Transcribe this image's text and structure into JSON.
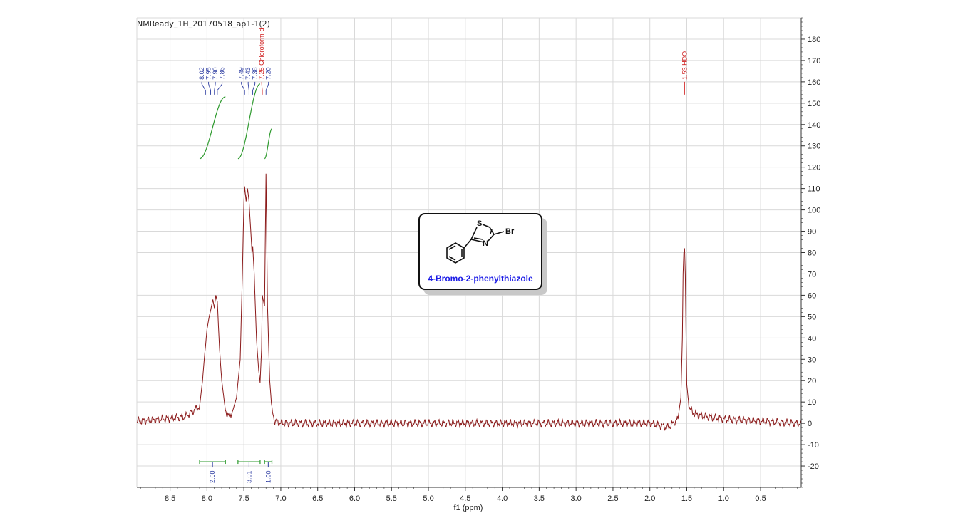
{
  "title": "NMReady_1H_20170518_ap1-1(2)",
  "compound": {
    "name": "4-Bromo-2-phenylthiazole",
    "atom_S": "S",
    "atom_N": "N",
    "atom_Br": "Br",
    "name_color": "#1a1ae6"
  },
  "colors": {
    "spectrum": "#8b1a1a",
    "integral": "#2e9a2e",
    "peak_label": "#2a3aa0",
    "solvent_label": "#d02020",
    "grid": "#d9d9d9",
    "axis": "#333333"
  },
  "chart_data": {
    "type": "line",
    "xlabel": "f1 (ppm)",
    "ylabel": "",
    "x_reversed": true,
    "xlim": [
      8.95,
      -0.05
    ],
    "ylim": [
      -30,
      190
    ],
    "grid": true,
    "x_ticks": [
      "8.5",
      "8.0",
      "7.5",
      "7.0",
      "6.5",
      "6.0",
      "5.5",
      "5.0",
      "4.5",
      "4.0",
      "3.5",
      "3.0",
      "2.5",
      "2.0",
      "1.5",
      "1.0",
      "0.5"
    ],
    "y_ticks": [
      "-20",
      "-10",
      "0",
      "10",
      "20",
      "30",
      "40",
      "50",
      "60",
      "70",
      "80",
      "90",
      "100",
      "110",
      "120",
      "130",
      "140",
      "150",
      "160",
      "170",
      "180"
    ],
    "series": [
      {
        "x": [
          8.95,
          8.6,
          8.3,
          8.1,
          8.06,
          8.03,
          8.02,
          8.0,
          7.97,
          7.95,
          7.92,
          7.9,
          7.88,
          7.86,
          7.83,
          7.8,
          7.75,
          7.7,
          7.65,
          7.6,
          7.55,
          7.52,
          7.5,
          7.49,
          7.47,
          7.45,
          7.43,
          7.41,
          7.39,
          7.38,
          7.36,
          7.33,
          7.3,
          7.28,
          7.26,
          7.25,
          7.24,
          7.22,
          7.2,
          7.18,
          7.15,
          7.12,
          7.08,
          7.0,
          6.5,
          6.0,
          5.0,
          4.0,
          3.0,
          2.0,
          1.75,
          1.62,
          1.58,
          1.56,
          1.55,
          1.54,
          1.53,
          1.52,
          1.51,
          1.5,
          1.47,
          1.42,
          1.35,
          1.2,
          1.0,
          0.5,
          0.0,
          -0.05
        ],
        "y": [
          1,
          2,
          3,
          8,
          20,
          33,
          36,
          44,
          50,
          53,
          58,
          54,
          60,
          57,
          35,
          20,
          6,
          3,
          6,
          12,
          30,
          70,
          104,
          111,
          104,
          110,
          104,
          92,
          80,
          83,
          70,
          40,
          25,
          19,
          35,
          60,
          58,
          55,
          117,
          55,
          20,
          6,
          1,
          0,
          0,
          0,
          0,
          0,
          0,
          0,
          -2,
          2,
          12,
          40,
          70,
          80,
          82,
          70,
          40,
          18,
          8,
          5,
          4,
          3,
          2,
          1,
          0,
          0
        ]
      }
    ],
    "peak_labels": [
      {
        "x": 8.02,
        "text": "8.02"
      },
      {
        "x": 7.95,
        "text": "7.95"
      },
      {
        "x": 7.9,
        "text": "7.90"
      },
      {
        "x": 7.86,
        "text": "7.86"
      },
      {
        "x": 7.49,
        "text": "7.49"
      },
      {
        "x": 7.43,
        "text": "7.43"
      },
      {
        "x": 7.38,
        "text": "7.38"
      },
      {
        "x": 7.25,
        "text": "7.25 Chloroform-d",
        "solvent": true
      },
      {
        "x": 7.2,
        "text": "7.20"
      },
      {
        "x": 1.53,
        "text": "1.53 HDO",
        "solvent": true
      }
    ],
    "integrals": [
      {
        "from": 8.1,
        "to": 7.75,
        "value": "2.00",
        "curve_y0": 124,
        "curve_y1": 153
      },
      {
        "from": 7.58,
        "to": 7.28,
        "value": "3.01",
        "curve_y0": 124,
        "curve_y1": 159
      },
      {
        "from": 7.22,
        "to": 7.12,
        "value": "1.00",
        "curve_y0": 124,
        "curve_y1": 138
      }
    ]
  }
}
